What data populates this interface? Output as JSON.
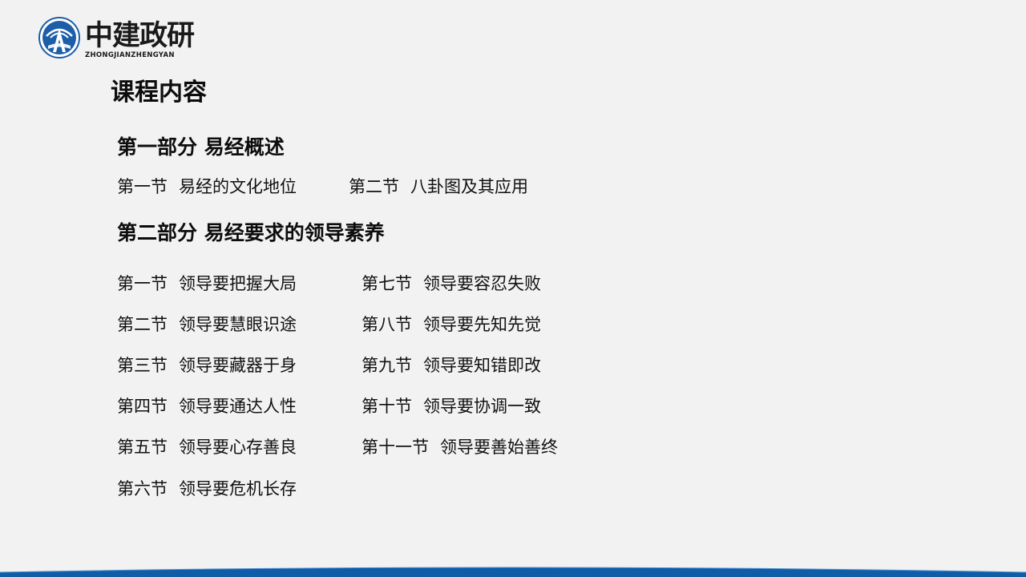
{
  "logo": {
    "name_cn": "中建政研",
    "name_en": "ZHONGJIANZHENGYAN"
  },
  "colors": {
    "background": "#f2f2f2",
    "brand_blue": "#1d5ea8",
    "footer_blue": "#0f5ca8"
  },
  "title": "课程内容",
  "part1": {
    "heading": "第一部分  易经概述",
    "items": [
      {
        "num": "第一节",
        "text": "易经的文化地位"
      },
      {
        "num": "第二节",
        "text": "八卦图及其应用"
      }
    ]
  },
  "part2": {
    "heading": "第二部分  易经要求的领导素养",
    "left_items": [
      {
        "num": "第一节",
        "text": "领导要把握大局"
      },
      {
        "num": "第二节",
        "text": "领导要慧眼识途"
      },
      {
        "num": "第三节",
        "text": "领导要藏器于身"
      },
      {
        "num": "第四节",
        "text": "领导要通达人性"
      },
      {
        "num": "第五节",
        "text": "领导要心存善良"
      },
      {
        "num": "第六节",
        "text": "领导要危机长存"
      }
    ],
    "right_items": [
      {
        "num": "第七节",
        "text": "领导要容忍失败"
      },
      {
        "num": "第八节",
        "text": "领导要先知先觉"
      },
      {
        "num": "第九节",
        "text": "领导要知错即改"
      },
      {
        "num": "第十节",
        "text": "领导要协调一致"
      },
      {
        "num": "第十一节",
        "text": "领导要善始善终"
      }
    ]
  }
}
